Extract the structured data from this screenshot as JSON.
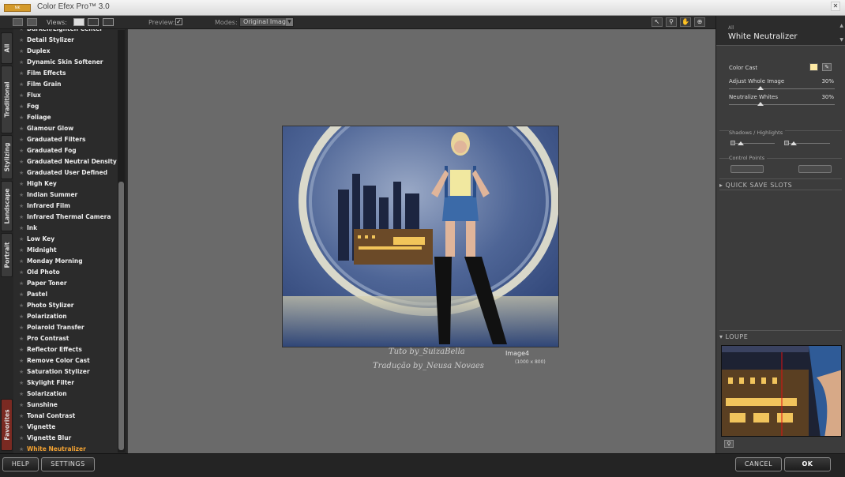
{
  "app": {
    "title": "Color Efex Pro™ 3.0",
    "logo_text": "NIK"
  },
  "toolbar": {
    "views_label": "Views:",
    "preview_label": "Preview:",
    "preview_checked": "✓",
    "modes_label": "Modes:",
    "modes_value": "Original Image",
    "tools": [
      "pointer-icon",
      "zoom-icon",
      "hand-icon",
      "pin-icon"
    ]
  },
  "side_tabs": [
    "All",
    "Traditional",
    "Stylizing",
    "Landscape",
    "Portrait",
    "Favorites"
  ],
  "filters": [
    "Darken/Lighten Center",
    "Detail Stylizer",
    "Duplex",
    "Dynamic Skin Softener",
    "Film Effects",
    "Film Grain",
    "Flux",
    "Fog",
    "Foliage",
    "Glamour Glow",
    "Graduated Filters",
    "Graduated Fog",
    "Graduated Neutral Density",
    "Graduated User Defined",
    "High Key",
    "Indian Summer",
    "Infrared Film",
    "Infrared Thermal Camera",
    "Ink",
    "Low Key",
    "Midnight",
    "Monday Morning",
    "Old Photo",
    "Paper Toner",
    "Pastel",
    "Photo Stylizer",
    "Polarization",
    "Polaroid Transfer",
    "Pro Contrast",
    "Reflector Effects",
    "Remove Color Cast",
    "Saturation Stylizer",
    "Skylight Filter",
    "Solarization",
    "Sunshine",
    "Tonal Contrast",
    "Vignette",
    "Vignette Blur",
    "White Neutralizer"
  ],
  "selected_filter": "White Neutralizer",
  "canvas": {
    "image_label": "Image4",
    "image_dims": "(1000 x 800)",
    "watermark_1": "Tuto by_SuizaBella",
    "watermark_2": "Tradução by_Neusa Novaes"
  },
  "panel": {
    "category": "All",
    "filter_name": "White Neutralizer",
    "color_cast_label": "Color Cast",
    "color_cast_color": "#fde9a4",
    "params": [
      {
        "label": "Adjust Whole Image",
        "value": "30%"
      },
      {
        "label": "Neutralize Whites",
        "value": "30%"
      }
    ],
    "shadows_highlights": "Shadows / Highlights",
    "control_points": "Control Points",
    "quick_save": "▸ QUICK SAVE SLOTS",
    "loupe": "▾ LOUPE"
  },
  "buttons": {
    "help": "HELP",
    "settings": "SETTINGS",
    "cancel": "CANCEL",
    "ok": "OK"
  }
}
